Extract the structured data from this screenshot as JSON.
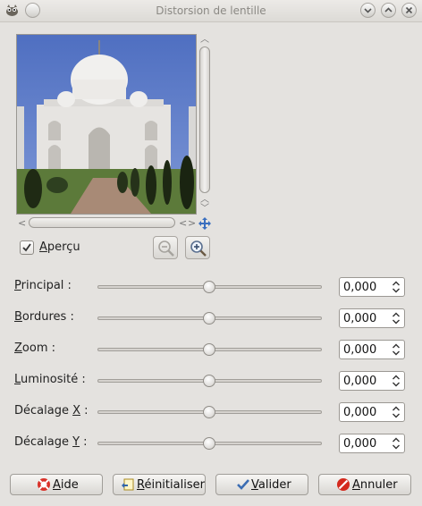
{
  "window": {
    "title": "Distorsion de lentille"
  },
  "preview": {
    "checkbox_label_mnemonic": "A",
    "checkbox_label_rest": "perçu",
    "checked": true
  },
  "params": [
    {
      "label_pre": "",
      "label_mnemonic": "P",
      "label_post": "rincipal :",
      "value": "0,000"
    },
    {
      "label_pre": "",
      "label_mnemonic": "B",
      "label_post": "ordures :",
      "value": "0,000"
    },
    {
      "label_pre": "",
      "label_mnemonic": "Z",
      "label_post": "oom :",
      "value": "0,000"
    },
    {
      "label_pre": "",
      "label_mnemonic": "L",
      "label_post": "uminosité :",
      "value": "0,000"
    },
    {
      "label_pre": "Décalage ",
      "label_mnemonic": "X",
      "label_post": " :",
      "value": "0,000"
    },
    {
      "label_pre": "Décalage ",
      "label_mnemonic": "Y",
      "label_post": " :",
      "value": "0,000"
    }
  ],
  "buttons": {
    "help": {
      "mnemonic": "A",
      "rest": "ide",
      "icon": "help-lifebuoy-icon"
    },
    "reset": {
      "mnemonic": "R",
      "rest": "éinitialiser",
      "icon": "reset-icon"
    },
    "ok": {
      "mnemonic": "V",
      "rest": "alider",
      "icon": "checkmark-icon"
    },
    "cancel": {
      "mnemonic": "A",
      "rest": "nnuler",
      "icon": "cancel-icon"
    }
  },
  "colors": {
    "window_bg": "#e4e2df",
    "sky": "#5b7ac6",
    "cancel_red": "#d42a1e",
    "ok_blue": "#3b6db3"
  }
}
